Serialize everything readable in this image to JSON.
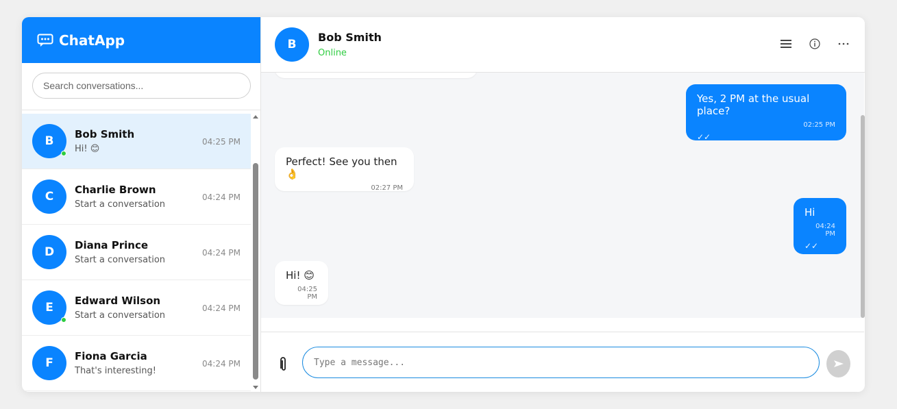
{
  "brand": {
    "title": "ChatApp",
    "icon": "chat-bubble-icon"
  },
  "search": {
    "placeholder": "Search conversations..."
  },
  "conversations": [
    {
      "initial": "B",
      "name": "Bob Smith",
      "preview": "Hi! 😊",
      "time": "04:25 PM",
      "online": true,
      "active": true
    },
    {
      "initial": "C",
      "name": "Charlie Brown",
      "preview": "Start a conversation",
      "time": "04:24 PM",
      "online": false,
      "active": false
    },
    {
      "initial": "D",
      "name": "Diana Prince",
      "preview": "Start a conversation",
      "time": "04:24 PM",
      "online": false,
      "active": false
    },
    {
      "initial": "E",
      "name": "Edward Wilson",
      "preview": "Start a conversation",
      "time": "04:24 PM",
      "online": true,
      "active": false
    },
    {
      "initial": "F",
      "name": "Fiona Garcia",
      "preview": "That's interesting!",
      "time": "04:24 PM",
      "online": false,
      "active": false
    }
  ],
  "chat_header": {
    "initial": "B",
    "name": "Bob Smith",
    "status": "Online",
    "actions": [
      "menu-icon",
      "info-icon",
      "more-icon"
    ]
  },
  "messages": [
    {
      "direction": "out",
      "text": "Yes, 2 PM at the usual place?",
      "time": "02:25 PM",
      "ticks": "✓✓"
    },
    {
      "direction": "in",
      "text": "Perfect! See you then 👌",
      "time": "02:27 PM"
    },
    {
      "direction": "out",
      "text": "Hi",
      "time": "04:24 PM",
      "ticks": "✓✓"
    },
    {
      "direction": "in",
      "text": "Hi! 😊",
      "time": "04:25 PM"
    }
  ],
  "composer": {
    "placeholder": "Type a message...",
    "attach_icon": "paperclip-icon",
    "send_icon": "send-icon"
  },
  "colors": {
    "accent": "#0a84ff",
    "online": "#2ecc40",
    "chat_bg": "#f5f6f8",
    "active_row": "#e3f1fd"
  }
}
